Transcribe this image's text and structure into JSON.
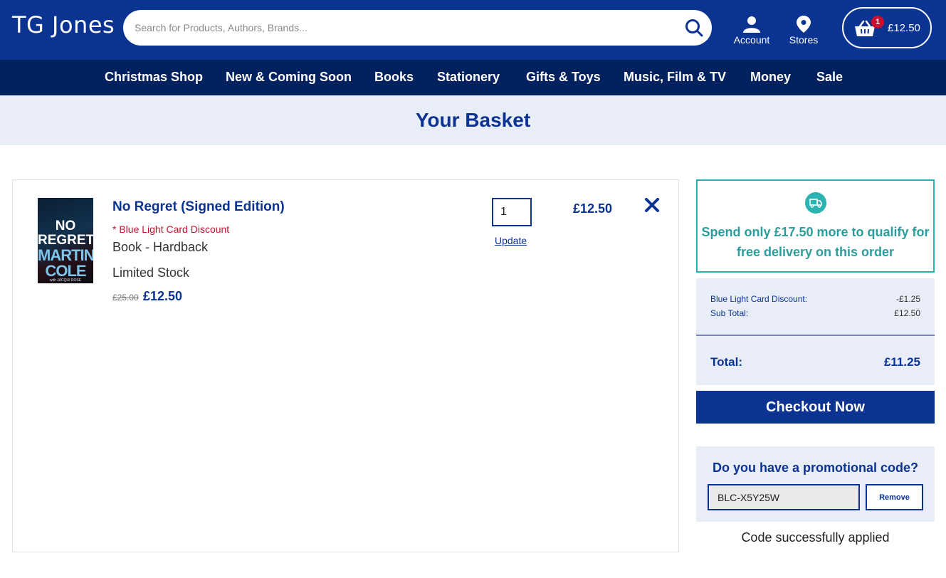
{
  "header": {
    "logo": "TG Jones",
    "search_placeholder": "Search for Products, Authors, Brands...",
    "account_label": "Account",
    "stores_label": "Stores",
    "basket_count": "1",
    "basket_total": "£12.50"
  },
  "nav": {
    "items": [
      "Christmas Shop",
      "New & Coming Soon",
      "Books",
      "Stationery",
      "Gifts & Toys",
      "Music, Film & TV",
      "Money",
      "Sale"
    ]
  },
  "page": {
    "title": "Your Basket"
  },
  "item": {
    "name": "No Regret (Signed Edition)",
    "discount_note": "* Blue Light Card Discount",
    "format": "Book - Hardback",
    "stock": "Limited Stock",
    "was_price": "£25.00",
    "now_price": "£12.50",
    "quantity": "1",
    "update_label": "Update",
    "line_price": "£12.50",
    "cover": {
      "title": "NO REGRET",
      "author": "MARTINA COLE",
      "coauthor": "with JACQUI ROSE"
    }
  },
  "delivery": {
    "message": "Spend only £17.50 more to qualify for free delivery on this order"
  },
  "summary": {
    "discount_label": "Blue Light Card Discount:",
    "discount_value": "-£1.25",
    "subtotal_label": "Sub Total:",
    "subtotal_value": "£12.50",
    "total_label": "Total:",
    "total_value": "£11.25"
  },
  "checkout": {
    "label": "Checkout Now"
  },
  "promo": {
    "title": "Do you have a promotional code?",
    "code": "BLC-X5Y25W",
    "remove_label": "Remove",
    "success_message": "Code successfully applied"
  },
  "colors": {
    "brand_blue": "#0a3392",
    "nav_blue": "#02215f",
    "teal": "#2ab3b1",
    "discount_red": "#c8102e",
    "light_band": "#e8edf7"
  }
}
